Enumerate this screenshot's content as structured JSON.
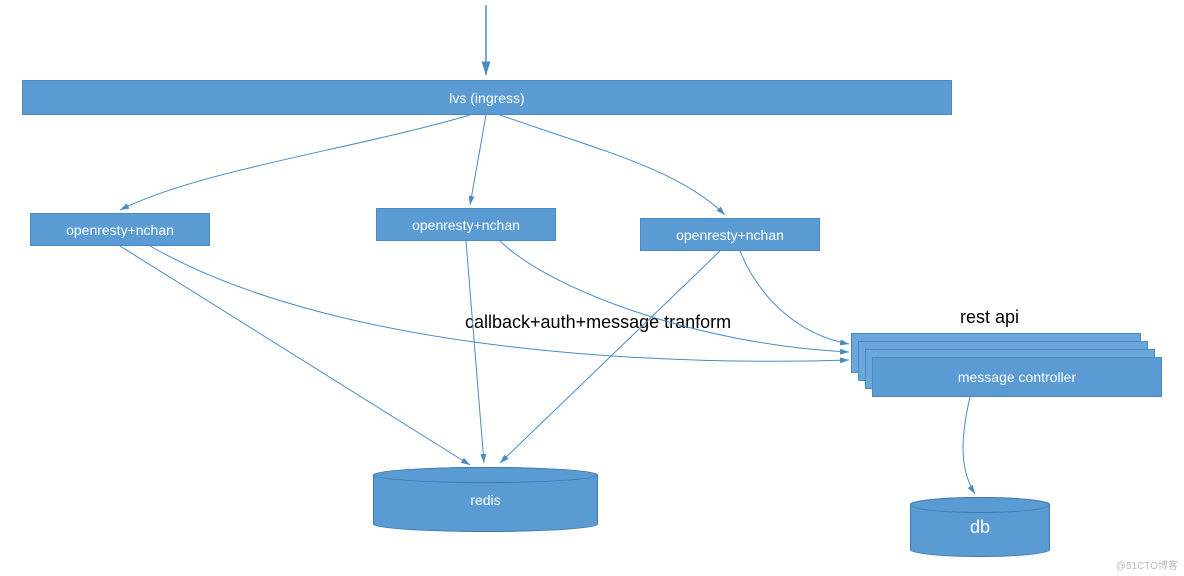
{
  "nodes": {
    "lvs": "lvs (ingress)",
    "openresty1": "openresty+nchan",
    "openresty2": "openresty+nchan",
    "openresty3": "openresty+nchan",
    "msg_controller": "message controller",
    "redis": "redis",
    "db": "db"
  },
  "labels": {
    "callback": "callback+auth+message tranform",
    "restapi": "rest api"
  },
  "watermark": "@51CTO博客",
  "chart_data": {
    "type": "diagram",
    "title": "",
    "nodes": [
      {
        "id": "entry",
        "label": "",
        "type": "arrow-start"
      },
      {
        "id": "lvs",
        "label": "lvs (ingress)",
        "type": "box"
      },
      {
        "id": "or1",
        "label": "openresty+nchan",
        "type": "box"
      },
      {
        "id": "or2",
        "label": "openresty+nchan",
        "type": "box"
      },
      {
        "id": "or3",
        "label": "openresty+nchan",
        "type": "box"
      },
      {
        "id": "mc",
        "label": "message controller",
        "type": "box-stack",
        "note": "rest api"
      },
      {
        "id": "redis",
        "label": "redis",
        "type": "cylinder"
      },
      {
        "id": "db",
        "label": "db",
        "type": "cylinder"
      }
    ],
    "edges": [
      {
        "from": "entry",
        "to": "lvs"
      },
      {
        "from": "lvs",
        "to": "or1"
      },
      {
        "from": "lvs",
        "to": "or2"
      },
      {
        "from": "lvs",
        "to": "or3"
      },
      {
        "from": "or1",
        "to": "redis"
      },
      {
        "from": "or2",
        "to": "redis"
      },
      {
        "from": "or3",
        "to": "redis"
      },
      {
        "from": "or1",
        "to": "mc",
        "label": "callback+auth+message tranform"
      },
      {
        "from": "or2",
        "to": "mc",
        "label": "callback+auth+message tranform"
      },
      {
        "from": "or3",
        "to": "mc",
        "label": "callback+auth+message tranform"
      },
      {
        "from": "mc",
        "to": "db"
      }
    ]
  }
}
